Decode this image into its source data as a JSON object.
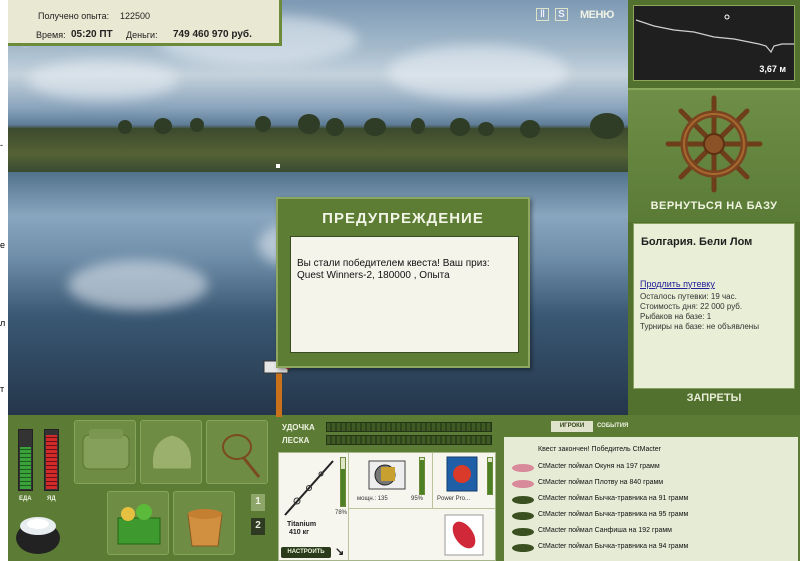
{
  "hud": {
    "experience_label": "Получено опыта:",
    "experience_value": "122500",
    "time_label": "Время:",
    "time_value": "05:20 ПТ",
    "money_label": "Деньги:",
    "money_value": "749 460 970 руб.",
    "pause_icon": "pause-icon",
    "sound_icon": "s-icon",
    "menu_label": "МЕНЮ"
  },
  "depth": {
    "value": "3,67 м"
  },
  "right_panel": {
    "back_to_base": "ВЕРНУТЬСЯ НА БАЗУ",
    "base_name": "Болгария. Бели Лом",
    "extend_link": "Продлить путевку",
    "remaining": "Осталось путевки: 19 час.",
    "day_cost": "Стоимость дня: 22 000 руб.",
    "fishers": "Рыбаков на базе: 1",
    "tournaments": "Турниры на базе: не объявлены",
    "restrictions": "ЗАПРЕТЫ"
  },
  "dialog": {
    "title": "ПРЕДУПРЕЖДЕНИЕ",
    "text": "Вы стали победителем квеста! Ваш приз: Quest Winners-2, 180000 , Опыта"
  },
  "status": {
    "food_label": "ЕДА",
    "food_level": 0.7,
    "poison_label": "ЯД",
    "poison_level": 0.9,
    "food_color": "#3aa23a",
    "poison_color": "#d02a2a"
  },
  "inventory": {
    "page1": "1",
    "page2": "2"
  },
  "gear": {
    "rod_label": "УДОЧКА",
    "line_label": "ЛЕСКА",
    "rod_name": "Titanium",
    "rod_mass": "410 кг",
    "rod_pct": "78%",
    "reel_power": "мощн.: 135",
    "reel_pct": "95%",
    "line_name": "Power Pro...",
    "tune_label": "НАСТРОИТЬ",
    "rod_level": 0.78,
    "reel_level": 0.95,
    "line_level": 0.9
  },
  "chat": {
    "tab_players": "ИГРОКИ",
    "tab_events": "СОБЫТИЯ",
    "messages": [
      "Квест закончен! Победитель CtMacter",
      "CtMacter поймал Окуня на 197 грамм",
      "CtMacter поймал Плотву на 840 грамм",
      "CtMacter поймал Бычка-травника на 91 грамм",
      "CtMacter поймал Бычка-травника на 95 грамм",
      "CtMacter поймал Санфиша на 192 грамм",
      "CtMacter поймал Бычка-травника на 94 грамм"
    ]
  }
}
